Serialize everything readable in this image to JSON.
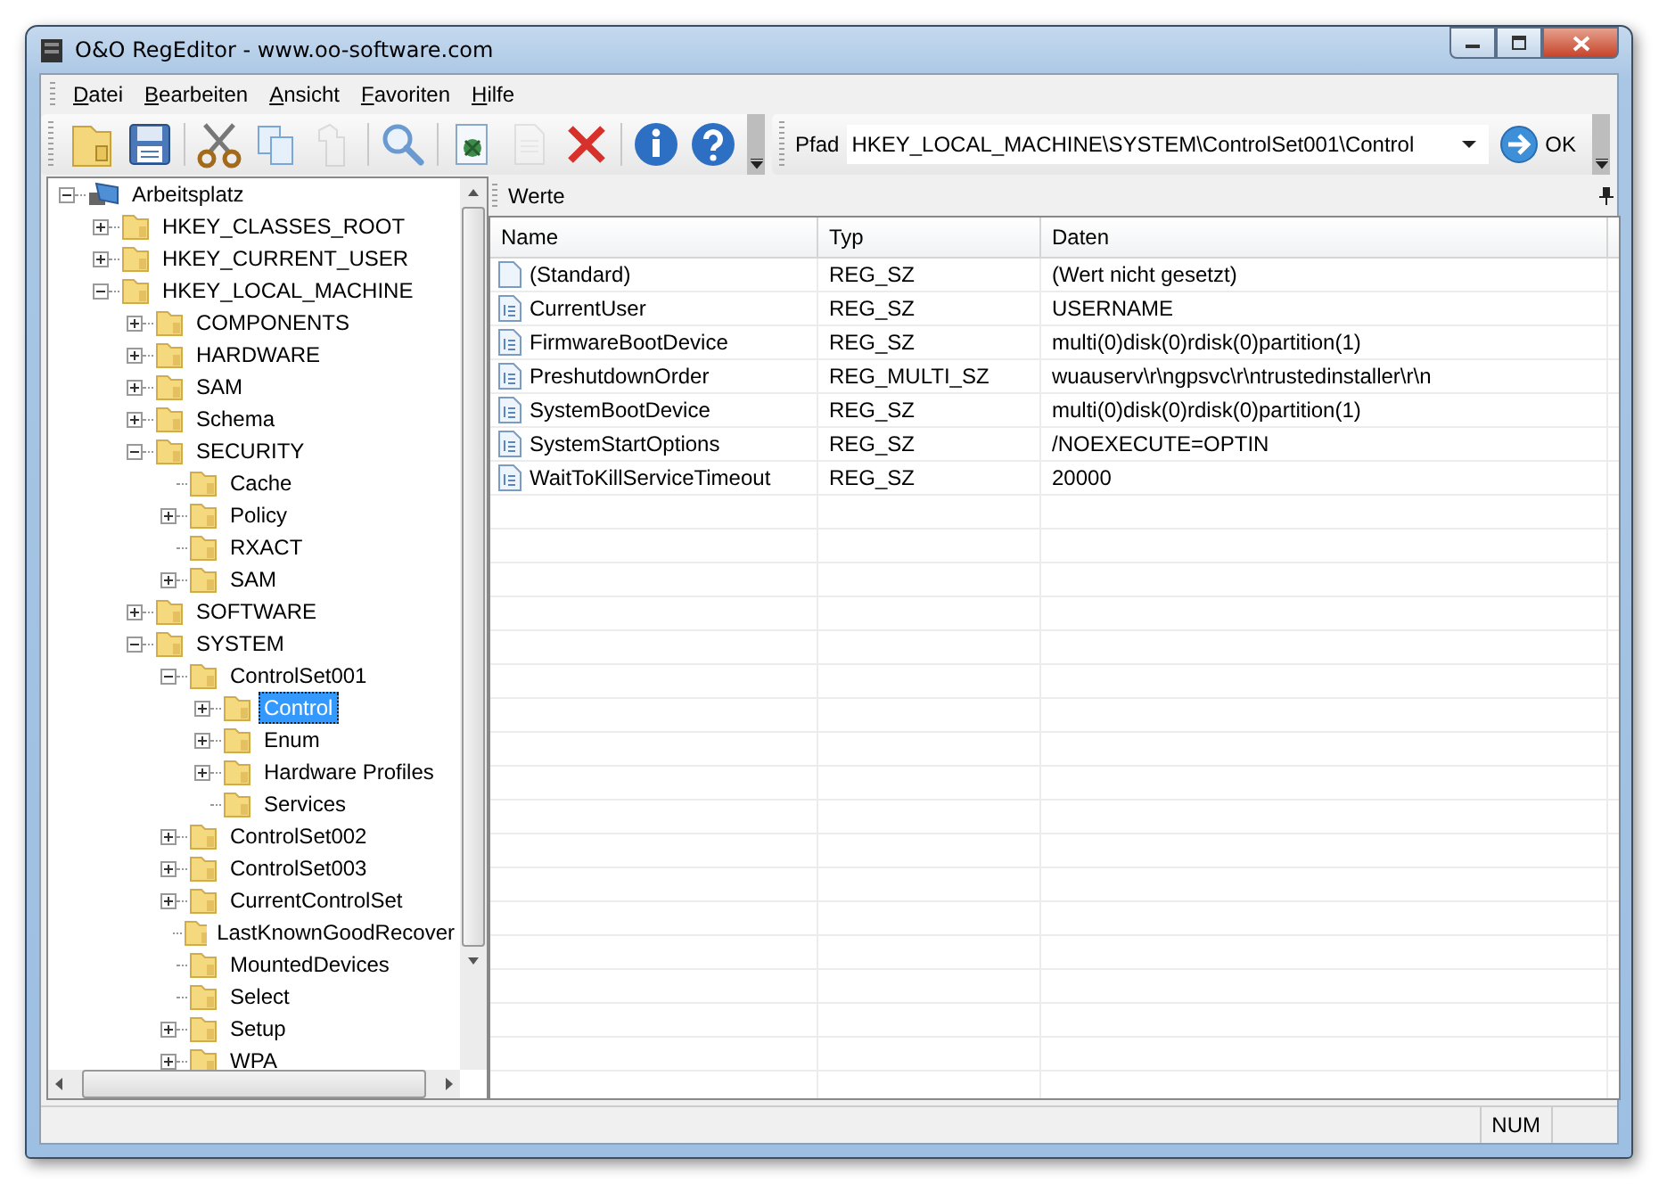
{
  "window": {
    "title": "O&O RegEditor - www.oo-software.com"
  },
  "menu": [
    "Datei",
    "Bearbeiten",
    "Ansicht",
    "Favoriten",
    "Hilfe"
  ],
  "toolbar": [
    {
      "kind": "open",
      "disabled": false
    },
    {
      "kind": "save",
      "disabled": false
    },
    {
      "kind": "separator"
    },
    {
      "kind": "cut",
      "disabled": false
    },
    {
      "kind": "copy",
      "disabled": false
    },
    {
      "kind": "paste",
      "disabled": true
    },
    {
      "kind": "separator"
    },
    {
      "kind": "search",
      "disabled": false
    },
    {
      "kind": "separator"
    },
    {
      "kind": "import",
      "disabled": false
    },
    {
      "kind": "new",
      "disabled": true
    },
    {
      "kind": "delete",
      "disabled": false
    },
    {
      "kind": "separator"
    },
    {
      "kind": "info",
      "disabled": false
    },
    {
      "kind": "help",
      "disabled": false
    }
  ],
  "path_bar": {
    "label": "Pfad",
    "value": "HKEY_LOCAL_MACHINE\\SYSTEM\\ControlSet001\\Control",
    "button": "OK"
  },
  "tree": [
    {
      "label": "Arbeitsplatz",
      "kind": "computer",
      "expanded": true,
      "selected": false,
      "children": [
        {
          "label": "HKEY_CLASSES_ROOT",
          "expanded": false,
          "selected": false
        },
        {
          "label": "HKEY_CURRENT_USER",
          "expanded": false,
          "selected": false
        },
        {
          "label": "HKEY_LOCAL_MACHINE",
          "expanded": true,
          "selected": false,
          "children": [
            {
              "label": "COMPONENTS",
              "expanded": false,
              "selected": false
            },
            {
              "label": "HARDWARE",
              "expanded": false,
              "selected": false
            },
            {
              "label": "SAM",
              "expanded": false,
              "selected": false
            },
            {
              "label": "Schema",
              "expanded": false,
              "selected": false
            },
            {
              "label": "SECURITY",
              "expanded": true,
              "selected": false,
              "children": [
                {
                  "label": "Cache",
                  "selected": false
                },
                {
                  "label": "Policy",
                  "expanded": false,
                  "selected": false
                },
                {
                  "label": "RXACT",
                  "selected": false
                },
                {
                  "label": "SAM",
                  "expanded": false,
                  "selected": false
                }
              ]
            },
            {
              "label": "SOFTWARE",
              "expanded": false,
              "selected": false
            },
            {
              "label": "SYSTEM",
              "expanded": true,
              "selected": false,
              "children": [
                {
                  "label": "ControlSet001",
                  "expanded": true,
                  "selected": false,
                  "children": [
                    {
                      "label": "Control",
                      "expanded": false,
                      "selected": true
                    },
                    {
                      "label": "Enum",
                      "expanded": false,
                      "selected": false
                    },
                    {
                      "label": "Hardware Profiles",
                      "expanded": false,
                      "selected": false
                    },
                    {
                      "label": "Services",
                      "selected": false
                    }
                  ]
                },
                {
                  "label": "ControlSet002",
                  "expanded": false,
                  "selected": false
                },
                {
                  "label": "ControlSet003",
                  "expanded": false,
                  "selected": false
                },
                {
                  "label": "CurrentControlSet",
                  "expanded": false,
                  "selected": false
                },
                {
                  "label": "LastKnownGoodRecover",
                  "selected": false
                },
                {
                  "label": "MountedDevices",
                  "selected": false
                },
                {
                  "label": "Select",
                  "selected": false
                },
                {
                  "label": "Setup",
                  "expanded": false,
                  "selected": false
                },
                {
                  "label": "WPA",
                  "expanded": false,
                  "selected": false
                }
              ]
            }
          ]
        }
      ]
    }
  ],
  "values_panel": {
    "title": "Werte",
    "columns": [
      "Name",
      "Typ",
      "Daten"
    ],
    "rows": [
      {
        "kind": "default",
        "name": "(Standard)",
        "type": "REG_SZ",
        "data": "(Wert nicht gesetzt)"
      },
      {
        "kind": "string",
        "name": "CurrentUser",
        "type": "REG_SZ",
        "data": "USERNAME"
      },
      {
        "kind": "string",
        "name": "FirmwareBootDevice",
        "type": "REG_SZ",
        "data": "multi(0)disk(0)rdisk(0)partition(1)"
      },
      {
        "kind": "string",
        "name": "PreshutdownOrder",
        "type": "REG_MULTI_SZ",
        "data": "wuauserv\\r\\ngpsvc\\r\\ntrustedinstaller\\r\\n"
      },
      {
        "kind": "string",
        "name": "SystemBootDevice",
        "type": "REG_SZ",
        "data": "multi(0)disk(0)rdisk(0)partition(1)"
      },
      {
        "kind": "string",
        "name": "SystemStartOptions",
        "type": "REG_SZ",
        "data": "/NOEXECUTE=OPTIN"
      },
      {
        "kind": "string",
        "name": "WaitToKillServiceTimeout",
        "type": "REG_SZ",
        "data": "20000"
      }
    ]
  },
  "status_bar": {
    "indicator": "NUM"
  }
}
